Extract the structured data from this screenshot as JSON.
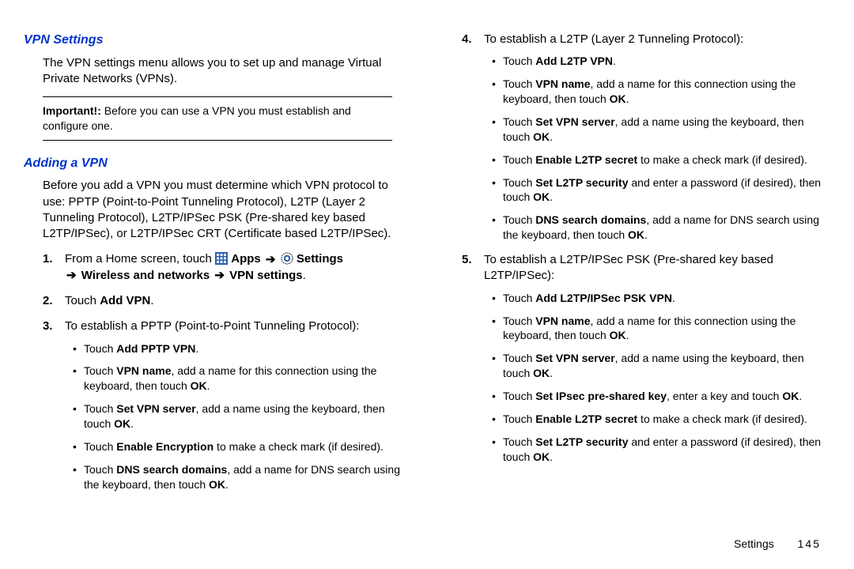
{
  "left": {
    "vpn_heading": "VPN Settings",
    "vpn_intro": "The VPN settings menu allows you to set up and manage Virtual Private Networks (VPNs).",
    "important_label": "Important!:",
    "important_text": " Before you can use a VPN you must establish and configure one.",
    "adding_heading": "Adding a VPN",
    "adding_intro": "Before you add a VPN you must determine which VPN protocol to use: PPTP (Point-to-Point Tunneling Protocol), L2TP (Layer 2 Tunneling Protocol), L2TP/IPSec PSK (Pre-shared key based L2TP/IPSec), or L2TP/IPSec CRT (Certificate based L2TP/IPSec).",
    "step1_pre": "From a Home screen, touch ",
    "apps_label": " Apps ",
    "settings_label": " Settings",
    "step1_line2_pre": " Wireless and networks ",
    "step1_line2_post": " VPN settings",
    "step2_pre": "Touch ",
    "step2_bold": "Add VPN",
    "step3": "To establish a PPTP (Point-to-Point Tunneling Protocol):",
    "s3b1_pre": "Touch ",
    "s3b1_b": "Add PPTP VPN",
    "s3b1_post": ".",
    "s3b2_pre": "Touch ",
    "s3b2_b": "VPN name",
    "s3b2_mid": ", add a name for this connection using the keyboard, then touch ",
    "s3b2_b2": "OK",
    "s3b2_post": ".",
    "s3b3_pre": "Touch ",
    "s3b3_b": "Set VPN server",
    "s3b3_mid": ", add a name using the keyboard, then touch ",
    "s3b3_b2": "OK",
    "s3b3_post": ".",
    "s3b4_pre": "Touch ",
    "s3b4_b": "Enable Encryption",
    "s3b4_post": " to make a check mark (if desired).",
    "s3b5_pre": "Touch ",
    "s3b5_b": "DNS search domains",
    "s3b5_mid": ", add a name for DNS search using the keyboard, then touch ",
    "s3b5_b2": "OK",
    "s3b5_post": "."
  },
  "right": {
    "step4": "To establish a L2TP (Layer 2 Tunneling Protocol):",
    "s4b1_pre": "Touch ",
    "s4b1_b": "Add L2TP VPN",
    "s4b1_post": ".",
    "s4b2_pre": "Touch ",
    "s4b2_b": "VPN name",
    "s4b2_mid": ", add a name for this connection using the keyboard, then touch ",
    "s4b2_b2": "OK",
    "s4b2_post": ".",
    "s4b3_pre": "Touch ",
    "s4b3_b": "Set VPN server",
    "s4b3_mid": ", add a name using the keyboard, then touch ",
    "s4b3_b2": "OK",
    "s4b3_post": ".",
    "s4b4_pre": "Touch ",
    "s4b4_b": "Enable L2TP secret",
    "s4b4_post": " to make a check mark (if desired).",
    "s4b5_pre": "Touch ",
    "s4b5_b": "Set L2TP security",
    "s4b5_mid": " and enter a password (if desired), then touch ",
    "s4b5_b2": "OK",
    "s4b5_post": ".",
    "s4b6_pre": "Touch ",
    "s4b6_b": "DNS search domains",
    "s4b6_mid": ", add a name for DNS search using the keyboard, then touch ",
    "s4b6_b2": "OK",
    "s4b6_post": ".",
    "step5": "To establish a L2TP/IPSec PSK (Pre-shared key based L2TP/IPSec):",
    "s5b1_pre": "Touch ",
    "s5b1_b": "Add L2TP/IPSec PSK VPN",
    "s5b1_post": ".",
    "s5b2_pre": "Touch ",
    "s5b2_b": "VPN name",
    "s5b2_mid": ", add a name for this connection using the keyboard, then touch ",
    "s5b2_b2": "OK",
    "s5b2_post": ".",
    "s5b3_pre": "Touch ",
    "s5b3_b": "Set VPN server",
    "s5b3_mid": ", add a name using the keyboard, then touch ",
    "s5b3_b2": "OK",
    "s5b3_post": ".",
    "s5b4_pre": "Touch ",
    "s5b4_b": "Set IPsec pre-shared key",
    "s5b4_mid": ", enter a key and touch ",
    "s5b4_b2": "OK",
    "s5b4_post": ".",
    "s5b5_pre": "Touch ",
    "s5b5_b": "Enable L2TP secret",
    "s5b5_post": " to make a check mark (if desired).",
    "s5b6_pre": "Touch ",
    "s5b6_b": "Set L2TP security",
    "s5b6_mid": " and enter a password (if desired), then touch ",
    "s5b6_b2": "OK",
    "s5b6_post": "."
  },
  "footer": {
    "section": "Settings",
    "page": "145"
  },
  "arrow": "➔"
}
